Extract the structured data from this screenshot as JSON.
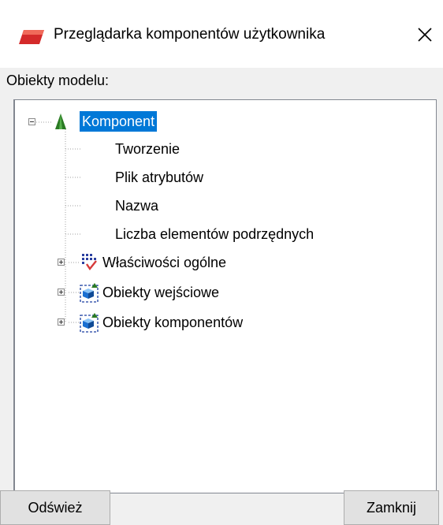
{
  "window": {
    "title": "Przeglądarka komponentów użytkownika",
    "close_glyph": "✕",
    "app_icon": "red-parallelogram-icon"
  },
  "tree_panel": {
    "label": "Obiekty modelu:",
    "nodes": [
      {
        "label": "Komponent",
        "icon": "green-cone-icon",
        "expanded": true,
        "selected": true
      },
      {
        "label": "Tworzenie"
      },
      {
        "label": "Plik atrybutów"
      },
      {
        "label": "Nazwa"
      },
      {
        "label": "Liczba elementów podrzędnych"
      },
      {
        "label": "Właściwości ogólne",
        "icon": "properties-grid-check-icon",
        "expanded": false
      },
      {
        "label": "Obiekty wejściowe",
        "icon": "blue-cube-selection-icon",
        "expanded": false
      },
      {
        "label": "Obiekty komponentów",
        "icon": "blue-cube-selection-icon",
        "expanded": false
      }
    ]
  },
  "buttons": {
    "refresh": "Odśwież",
    "close": "Zamknij"
  },
  "colors": {
    "selection": "#0078d7",
    "app_icon_red": "#d42a2a",
    "cone_green": "#2a7a23",
    "cube_blue": "#1a6fd1"
  }
}
